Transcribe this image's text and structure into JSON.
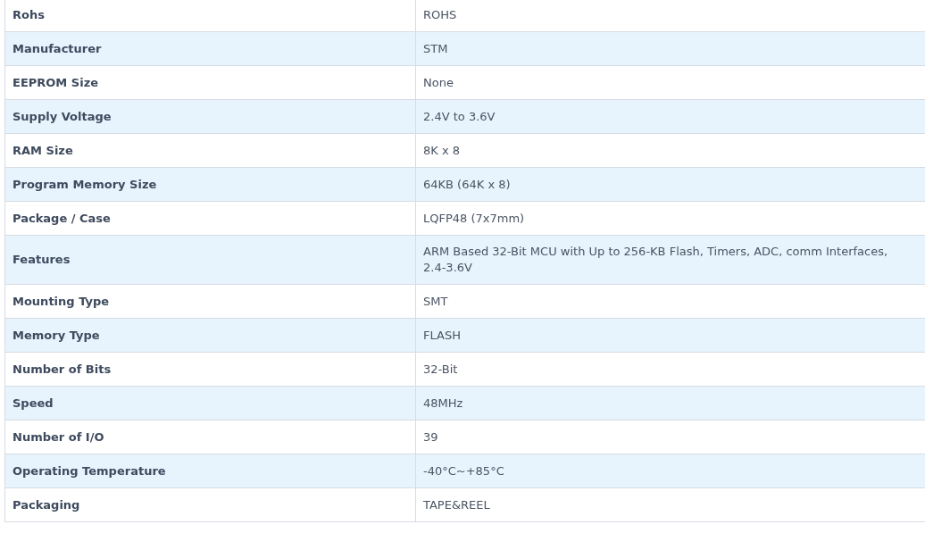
{
  "specs": [
    {
      "label": "Rohs",
      "value": "ROHS"
    },
    {
      "label": "Manufacturer",
      "value": "STM"
    },
    {
      "label": "EEPROM Size",
      "value": "None"
    },
    {
      "label": "Supply Voltage",
      "value": "2.4V to 3.6V"
    },
    {
      "label": "RAM Size",
      "value": "8K x 8"
    },
    {
      "label": "Program Memory Size",
      "value": "64KB (64K x 8)"
    },
    {
      "label": "Package / Case",
      "value": "LQFP48 (7x7mm)"
    },
    {
      "label": "Features",
      "value": "ARM Based 32-Bit MCU with Up to 256-KB Flash, Timers, ADC, comm Interfaces, 2.4-3.6V"
    },
    {
      "label": "Mounting Type",
      "value": "SMT"
    },
    {
      "label": "Memory Type",
      "value": "FLASH"
    },
    {
      "label": "Number of Bits",
      "value": "32-Bit"
    },
    {
      "label": "Speed",
      "value": "48MHz"
    },
    {
      "label": "Number of I/O",
      "value": "39"
    },
    {
      "label": "Operating Temperature",
      "value": "-40°C~+85°C"
    },
    {
      "label": "Packaging",
      "value": "TAPE&REEL"
    }
  ]
}
